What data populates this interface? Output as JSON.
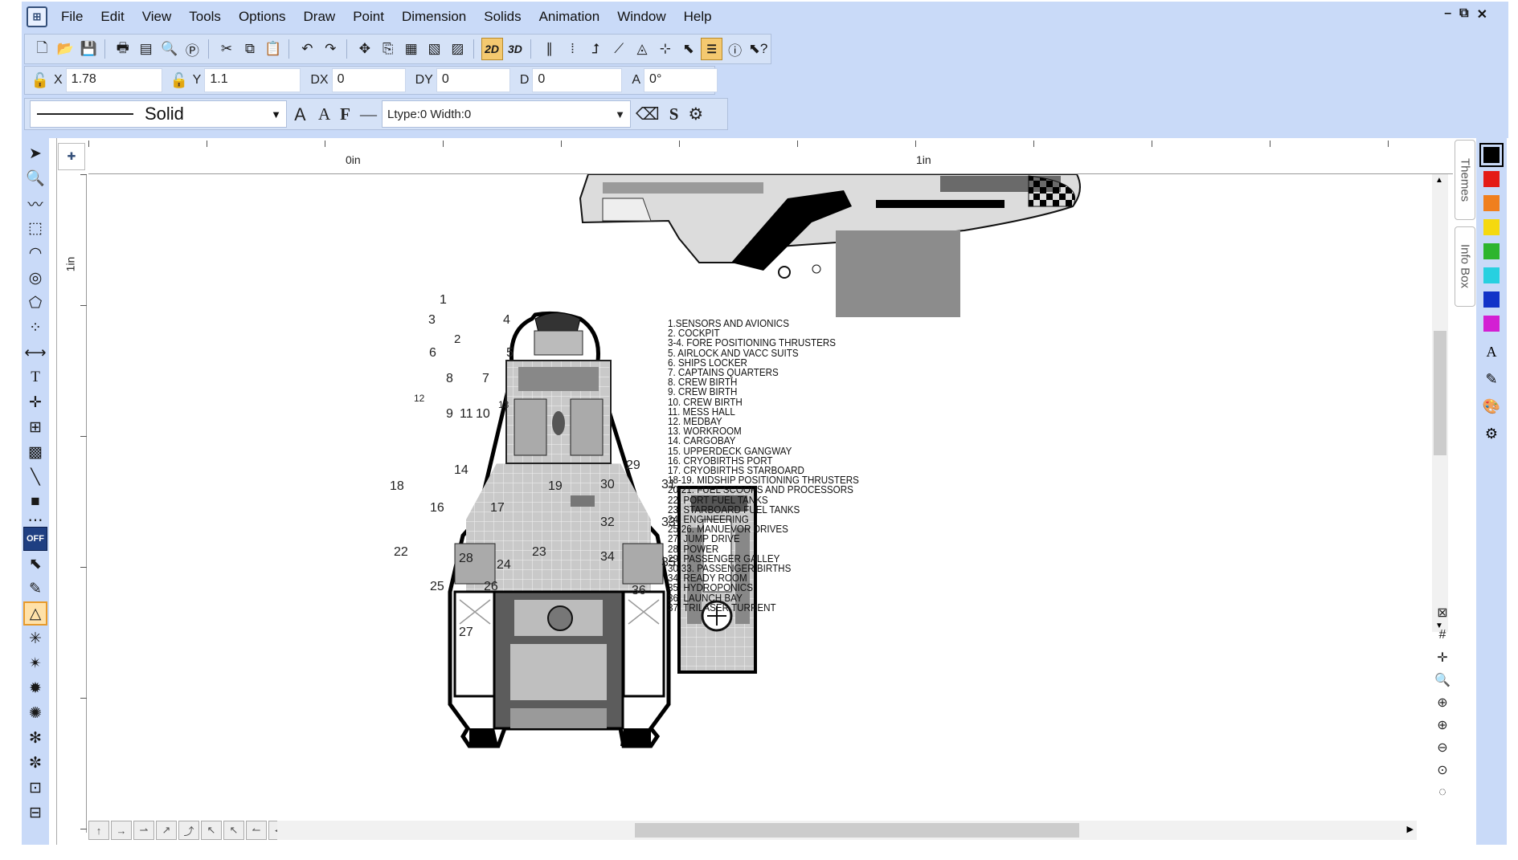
{
  "menu": [
    "File",
    "Edit",
    "View",
    "Tools",
    "Options",
    "Draw",
    "Point",
    "Dimension",
    "Solids",
    "Animation",
    "Window",
    "Help"
  ],
  "window_controls": [
    "–",
    "⧉",
    "✕"
  ],
  "toolbar": {
    "btn_2d": "2D",
    "btn_3d": "3D"
  },
  "coords": {
    "x_label": "X",
    "x_value": "1.78",
    "y_label": "Y",
    "y_value": "1.1",
    "dx_label": "DX",
    "dx_value": "0",
    "dy_label": "DY",
    "dy_value": "0",
    "d_label": "D",
    "d_value": "0",
    "a_label": "A",
    "a_value": "0°"
  },
  "line": {
    "style": "Solid",
    "ltype": "Ltype:0  Width:0",
    "fmt_s": "S"
  },
  "ruler": {
    "h0": "0in",
    "h1": "1in",
    "v1": "1in"
  },
  "side_tabs": [
    "Themes",
    "Info Box"
  ],
  "off_label": "OFF",
  "palette": [
    "#000000",
    "#e41b17",
    "#f07f1e",
    "#f5d90f",
    "#2db52d",
    "#27d0e0",
    "#1233c8",
    "#d31fd3"
  ],
  "legend": [
    "1.SENSORS AND AVIONICS",
    "2. COCKPIT",
    "3-4. FORE POSITIONING THRUSTERS",
    "5. AIRLOCK AND VACC SUITS",
    "6. SHIPS LOCKER",
    "7. CAPTAINS QUARTERS",
    "8. CREW BIRTH",
    "9. CREW BIRTH",
    "10. CREW BIRTH",
    "11. MESS HALL",
    "12. MEDBAY",
    "13. WORKROOM",
    "14. CARGOBAY",
    "15. UPPERDECK GANGWAY",
    "16. CRYOBIRTHS PORT",
    "17. CRYOBIRTHS STARBOARD",
    "18-19. MIDSHIP POSITIONING THRUSTERS",
    "20-21. FUEL SCOOPS AND PROCESSORS",
    "22. PORT FUEL TANKS",
    "23. STARBOARD FUEL TANKS",
    "24. ENGINEERING",
    "25-26. MANUEVOR DRIVES",
    "27. JUMP DRIVE",
    "28. POWER",
    "29. PASSENGER GALLEY",
    "30-33. PASSENGER BIRTHS",
    "34. READY ROOM",
    "35. HYDROPONICS",
    "36. LAUNCH BAY",
    "37. TRILASER TURRENT"
  ],
  "plan_numbers": [
    "1",
    "2",
    "3",
    "4",
    "5",
    "6",
    "7",
    "8",
    "9",
    "10",
    "11",
    "12",
    "13",
    "14",
    "16",
    "17",
    "18",
    "19",
    "22",
    "23",
    "24",
    "25",
    "26",
    "27",
    "28",
    "29",
    "30",
    "31",
    "32",
    "33",
    "34",
    "35",
    "36"
  ]
}
